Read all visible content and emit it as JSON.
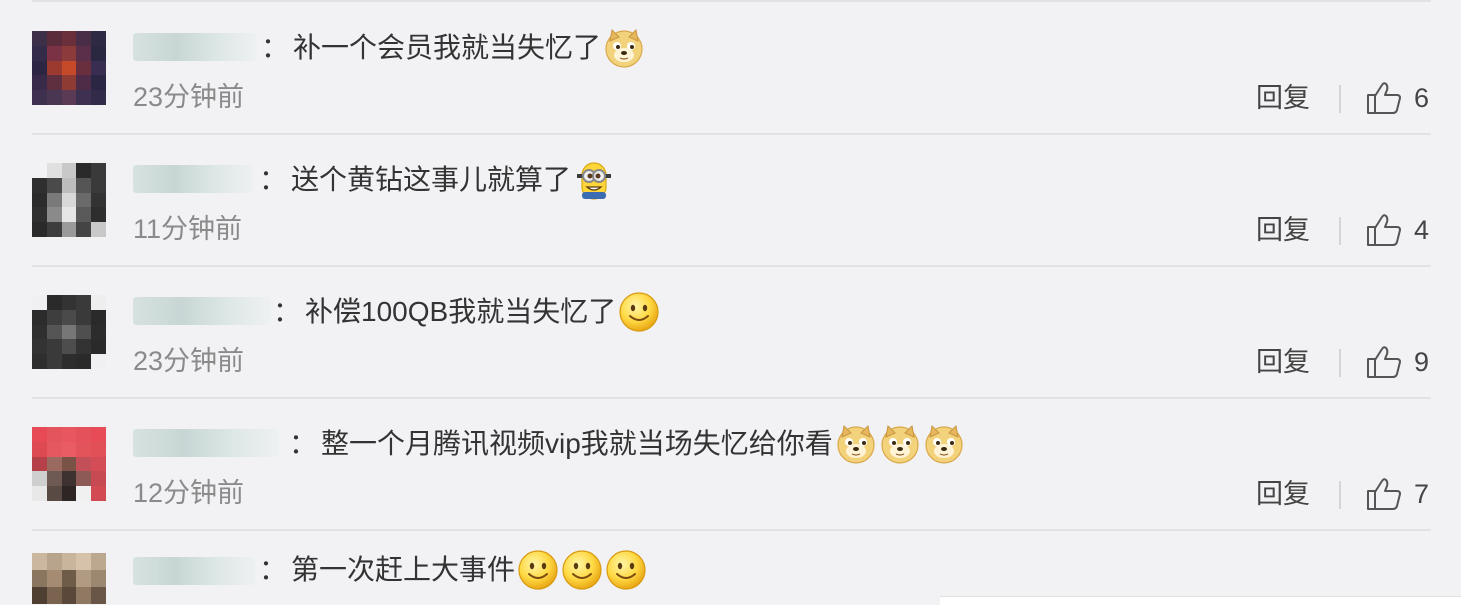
{
  "comments": [
    {
      "text": "补一个会员我就当失忆了",
      "time": "23分钟前",
      "reply": "回复",
      "likes": "6",
      "emojis": [
        "doge"
      ]
    },
    {
      "text": "送个黄钻这事儿就算了",
      "time": "11分钟前",
      "reply": "回复",
      "likes": "4",
      "emojis": [
        "minion"
      ]
    },
    {
      "text": "补偿100QB我就当失忆了",
      "time": "23分钟前",
      "reply": "回复",
      "likes": "9",
      "emojis": [
        "smile"
      ]
    },
    {
      "text": "整一个月腾讯视频vip我就当场失忆给你看",
      "time": "12分钟前",
      "reply": "回复",
      "likes": "7",
      "emojis": [
        "doge",
        "doge",
        "doge"
      ]
    },
    {
      "text": "第一次赶上大事件",
      "emojis": [
        "smile",
        "smile",
        "smile"
      ]
    }
  ],
  "colon": "：",
  "colors": {
    "background": "#f2f2f5",
    "text": "#333333",
    "time": "#8a8a8a",
    "divider": "#e2e2e6"
  },
  "icons": {
    "like": "thumbs-up-icon",
    "doge": "doge-emoji-icon",
    "minion": "minion-emoji-icon",
    "smile": "smile-emoji-icon"
  }
}
